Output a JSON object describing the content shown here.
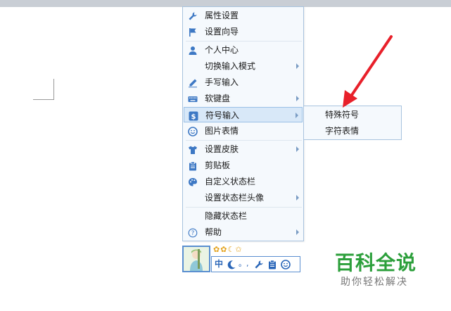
{
  "context_menu": {
    "items": [
      {
        "label": "属性设置",
        "icon": "wrench-icon",
        "has_submenu": false
      },
      {
        "label": "设置向导",
        "icon": "flag-icon",
        "has_submenu": false
      },
      {
        "label": "个人中心",
        "icon": "person-icon",
        "has_submenu": false
      },
      {
        "label": "切换输入模式",
        "icon": "",
        "has_submenu": true
      },
      {
        "label": "手写输入",
        "icon": "pen-icon",
        "has_submenu": false
      },
      {
        "label": "软键盘",
        "icon": "keyboard-icon",
        "has_submenu": true
      },
      {
        "label": "符号输入",
        "icon": "dollar-icon",
        "has_submenu": true,
        "active": true
      },
      {
        "label": "图片表情",
        "icon": "smiley-icon",
        "has_submenu": false
      },
      {
        "label": "设置皮肤",
        "icon": "shirt-icon",
        "has_submenu": true
      },
      {
        "label": "剪贴板",
        "icon": "clipboard-icon",
        "has_submenu": false
      },
      {
        "label": "自定义状态栏",
        "icon": "palette-icon",
        "has_submenu": false
      },
      {
        "label": "设置状态栏头像",
        "icon": "",
        "has_submenu": true
      },
      {
        "label": "隐藏状态栏",
        "icon": "",
        "has_submenu": false
      },
      {
        "label": "帮助",
        "icon": "help-icon",
        "has_submenu": true
      }
    ]
  },
  "submenu": {
    "items": [
      {
        "label": "特殊符号"
      },
      {
        "label": "字符表情"
      }
    ]
  },
  "status_bar": {
    "mode_label": "中",
    "punct_label": "。,",
    "top_icons": [
      "sun-icon",
      "sun-icon",
      "moon-icon",
      "star-icon"
    ]
  },
  "watermark": {
    "title": "百科全说",
    "subtitle": "助你轻松解决"
  },
  "colors": {
    "menu_bg": "#f5f9fd",
    "menu_border": "#a8c3de",
    "highlight": "#d8e8f8",
    "arrow_red": "#e8202a",
    "icon_blue": "#3d78c4",
    "watermark_green": "#2c9f3b"
  }
}
